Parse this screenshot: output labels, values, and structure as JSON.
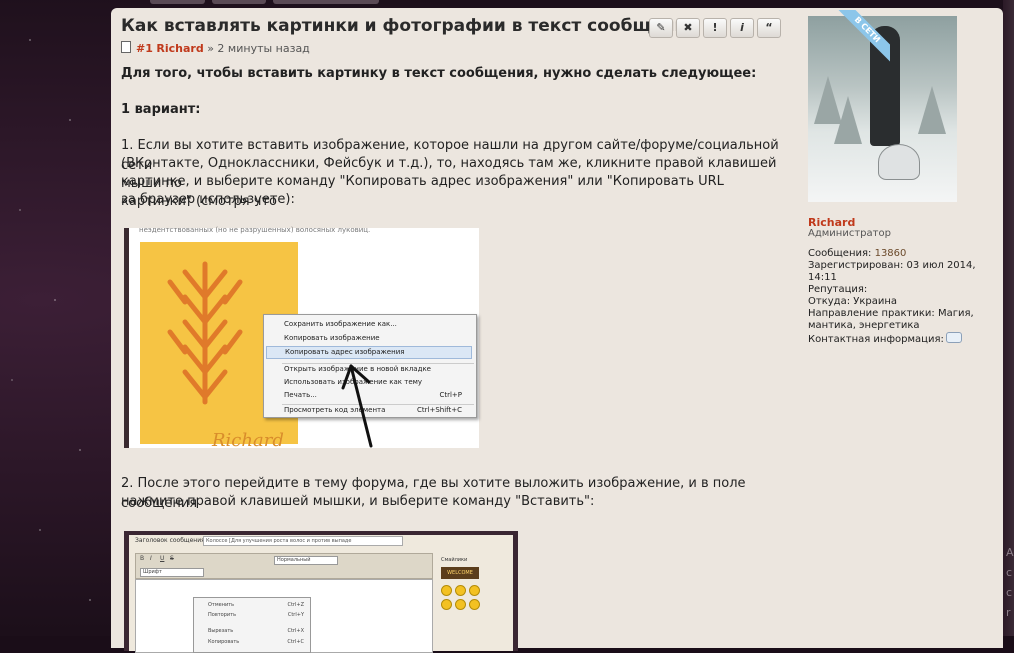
{
  "post": {
    "title": "Как вставлять картинки и фотографии в текст сообщения",
    "number": "#1",
    "author": "Richard",
    "time": "» 2 минуты назад",
    "actions": [
      "✎",
      "✖",
      "!",
      "i",
      "“"
    ]
  },
  "body": {
    "intro": "Для того, чтобы вставить картинку в текст сообщения, нужно сделать следующее:",
    "variant": "1 вариант:",
    "step1_l1": "1. Если вы хотите вставить изображение, которое нашли на другом сайте/форуме/социальной сети",
    "step1_l2": "(ВКонтакте, Одноклассники, Фейсбук и т.д.), то, находясь там же, кликните правой клавишей мыши по",
    "step1_l3": "картинке, и выберите команду \"Копировать адрес изображения\" или \"Копировать URL картинки\" (смотря что",
    "step1_l4": "за браузер используете):",
    "step2_l1": "2. После этого перейдите в тему форума, где вы хотите выложить изображение, и в поле сообщения",
    "step2_l2": "нажмите правой клавишей мышки, и выберите команду \"Вставить\":"
  },
  "screenshot1": {
    "caption": "неэдентствованных (но не разрушенных) волосяных луковиц.",
    "watermark": "Richard",
    "menu": [
      {
        "label": "Сохранить изображение как...",
        "shortcut": ""
      },
      {
        "label": "Копировать изображение",
        "shortcut": ""
      },
      {
        "label": "Копировать адрес изображения",
        "shortcut": "",
        "highlighted": true
      },
      {
        "label": "Открыть изображение в новой вкладке",
        "shortcut": ""
      },
      {
        "label": "Использовать изображение как тему",
        "shortcut": ""
      },
      {
        "label": "Печать...",
        "shortcut": "Ctrl+P"
      },
      {
        "label": "Просмотреть код элемента",
        "shortcut": "Ctrl+Shift+C"
      }
    ]
  },
  "screenshot2": {
    "subject_label": "Заголовок сообщения:",
    "subject_value": "Колоссе [Для улучшения роста волос и против выпаде",
    "font_select": "Шрифт",
    "size_select": "Нормальный",
    "smilies_label": "Смайлики",
    "welcome": "WELCOME",
    "menu": [
      {
        "label": "Отменить",
        "shortcut": "Ctrl+Z"
      },
      {
        "label": "Повторить",
        "shortcut": "Ctrl+Y"
      },
      {
        "label": "Вырезать",
        "shortcut": "Ctrl+X"
      },
      {
        "label": "Копировать",
        "shortcut": "Ctrl+C"
      }
    ]
  },
  "sidebar": {
    "online_badge": "В СЕТИ",
    "username": "Richard",
    "role": "Администратор",
    "posts_label": "Сообщения:",
    "posts_value": "13860",
    "registered_label": "Зарегистрирован:",
    "registered_value": "03 июл 2014, 14:11",
    "reputation_label": "Репутация:",
    "from_label": "Откуда:",
    "from_value": "Украина",
    "practice_label": "Направление практики:",
    "practice_value": "Магия, мантика, энергетика",
    "contact_label": "Контактная информация:"
  }
}
